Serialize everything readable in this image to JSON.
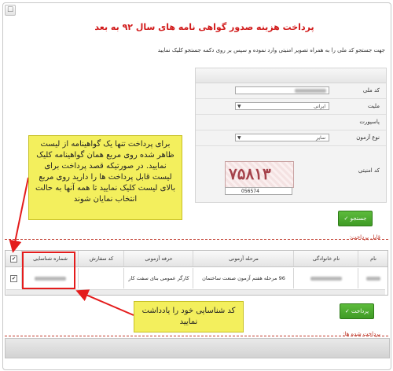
{
  "title": "پرداخت هزینه صدور گواهی نامه های سال ۹۲ به بعد",
  "instruction": "جهت جستجو کد ملی را به همراه تصویر امنیتی وارد نموده و سپس بر روی دکمه جستجو کلیک نمایید",
  "form": {
    "national_code_label": "کد ملی",
    "nationality_label": "ملیت",
    "nationality_value": "ایرانی",
    "passport_label": "پاسپورت",
    "exam_type_label": "نوع آزمون",
    "exam_type_value": "سایر",
    "security_code_label": "کد امنیتی",
    "captcha_text": "۷۵۸۱۳",
    "captcha_input_value": "056574"
  },
  "buttons": {
    "search": "جستجو ✓",
    "pay": "پرداخت ✓"
  },
  "sections": {
    "payable_label": "قابل پرداخت:",
    "paid_label": "پرداخت شده ها:"
  },
  "table": {
    "headers": [
      "نام",
      "نام خانوادگی",
      "مرحله آزمونی",
      "حرفه آزمونی",
      "کد سفارش",
      "شماره شناسایی"
    ],
    "row": {
      "stage": "96 مرحله هفتم آزمون صنعت ساختمان",
      "profession": "کارگر عمومی بنای سفت کار",
      "order_code": ""
    }
  },
  "notes": {
    "note1": "برای پرداخت تنها یک گواهینامه از لیست ظاهر شده روی مربع همان گواهینامه کلیک نمایید. در صورتیکه قصد پرداخت برای لیست قابل پرداخت ها را دارید روی مربع بالای لیست کلیک نمایید تا همه آنها به حالت انتخاب نمایان شوند",
    "note2": "کد شناسایی خود را یادداشت نمایید"
  },
  "colors": {
    "title": "#d11a1a",
    "note_bg": "#f3ef5d",
    "highlight": "#e41c1c",
    "button_green": "#3f9b25"
  }
}
